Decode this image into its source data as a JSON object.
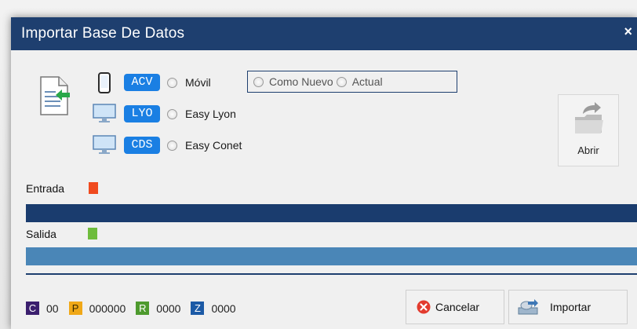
{
  "window": {
    "title": "Importar Base De Datos",
    "close_glyph": "×"
  },
  "sources": [
    {
      "icon": "phone-icon",
      "tag": "ACV",
      "label": "Móvil"
    },
    {
      "icon": "monitor-icon",
      "tag": "LYO",
      "label": "Easy Lyon"
    },
    {
      "icon": "monitor-icon",
      "tag": "CDS",
      "label": "Easy Conet"
    }
  ],
  "mode": {
    "options": [
      "Como Nuevo",
      "Actual"
    ]
  },
  "open_button": {
    "label": "Abrir"
  },
  "progress": {
    "entrada": {
      "label": "Entrada",
      "led_text": ".",
      "led_color": "#f04a1e",
      "bar_color": "#1a3c6e"
    },
    "salida": {
      "label": "Salida",
      "led_text": ".",
      "led_color": "#6ebc3c",
      "bar_color": "#4a86b7"
    }
  },
  "stats": [
    {
      "key": "C",
      "value": "00",
      "color": "#3b1f6e"
    },
    {
      "key": "P",
      "value": "000000",
      "color": "#f0a818"
    },
    {
      "key": "R",
      "value": "0000",
      "color": "#4e9a2e"
    },
    {
      "key": "Z",
      "value": "0000",
      "color": "#1c5aa6"
    }
  ],
  "actions": {
    "cancel_label": "Cancelar",
    "import_label": "Importar"
  }
}
